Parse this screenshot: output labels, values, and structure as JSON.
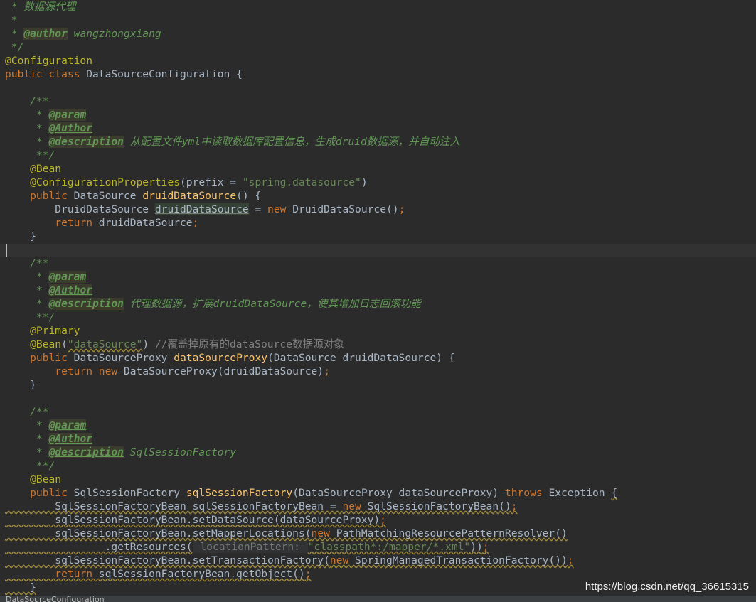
{
  "editor": {
    "lines": [
      [
        {
          "t": " * 数据源代理",
          "c": "cm"
        }
      ],
      [
        {
          "t": " *",
          "c": "cm"
        }
      ],
      [
        {
          "t": " * ",
          "c": "cm"
        },
        {
          "t": "@author",
          "c": "tag"
        },
        {
          "t": " wangzhongxiang",
          "c": "cm"
        }
      ],
      [
        {
          "t": " */",
          "c": "cm"
        }
      ],
      [
        {
          "t": "@Configuration",
          "c": "ann"
        }
      ],
      [
        {
          "t": "public class ",
          "c": "kw"
        },
        {
          "t": "DataSourceConfiguration {",
          "c": "pl"
        }
      ],
      [],
      [
        {
          "t": "    /**",
          "c": "cm"
        }
      ],
      [
        {
          "t": "     * ",
          "c": "cm"
        },
        {
          "t": "@param",
          "c": "tag"
        }
      ],
      [
        {
          "t": "     * ",
          "c": "cm"
        },
        {
          "t": "@Author",
          "c": "tag"
        }
      ],
      [
        {
          "t": "     * ",
          "c": "cm"
        },
        {
          "t": "@description",
          "c": "tag"
        },
        {
          "t": " 从配置文件",
          "c": "cm"
        },
        {
          "t": "yml",
          "c": "cm"
        },
        {
          "t": "中读取数据库配置信息，生成",
          "c": "cm"
        },
        {
          "t": "druid",
          "c": "cm"
        },
        {
          "t": "数据源，并自动注入",
          "c": "cm"
        }
      ],
      [
        {
          "t": "     **/",
          "c": "cm"
        }
      ],
      [
        {
          "t": "    @Bean",
          "c": "ann"
        }
      ],
      [
        {
          "t": "    @ConfigurationProperties",
          "c": "ann"
        },
        {
          "t": "(prefix = ",
          "c": "pl"
        },
        {
          "t": "\"spring.datasource\"",
          "c": "str"
        },
        {
          "t": ")",
          "c": "pl"
        }
      ],
      [
        {
          "t": "    public ",
          "c": "kw"
        },
        {
          "t": "DataSource ",
          "c": "pl"
        },
        {
          "t": "druidDataSource",
          "c": "fn"
        },
        {
          "t": "() {",
          "c": "pl"
        }
      ],
      [
        {
          "t": "        DruidDataSource ",
          "c": "pl"
        },
        {
          "t": "druidDataSource",
          "c": "pl hlvar"
        },
        {
          "t": " = ",
          "c": "pl"
        },
        {
          "t": "new ",
          "c": "kw"
        },
        {
          "t": "DruidDataSource()",
          "c": "pl"
        },
        {
          "t": ";",
          "c": "kw"
        }
      ],
      [
        {
          "t": "        return ",
          "c": "kw"
        },
        {
          "t": "druidDataSource",
          "c": "pl"
        },
        {
          "t": ";",
          "c": "kw"
        }
      ],
      [
        {
          "t": "    }",
          "c": "pl"
        }
      ],
      [],
      [
        {
          "t": "    /**",
          "c": "cm"
        }
      ],
      [
        {
          "t": "     * ",
          "c": "cm"
        },
        {
          "t": "@param",
          "c": "tag"
        }
      ],
      [
        {
          "t": "     * ",
          "c": "cm"
        },
        {
          "t": "@Author",
          "c": "tag"
        }
      ],
      [
        {
          "t": "     * ",
          "c": "cm"
        },
        {
          "t": "@description",
          "c": "tag"
        },
        {
          "t": " 代理数据源，扩展",
          "c": "cm"
        },
        {
          "t": "druidDataSource",
          "c": "cm"
        },
        {
          "t": "，使其增加日志回滚功能",
          "c": "cm"
        }
      ],
      [
        {
          "t": "     **/",
          "c": "cm"
        }
      ],
      [
        {
          "t": "    @Primary",
          "c": "ann"
        }
      ],
      [
        {
          "t": "    @Bean",
          "c": "ann"
        },
        {
          "t": "(",
          "c": "pl"
        },
        {
          "t": "\"dataSource\"",
          "c": "str warn"
        },
        {
          "t": ") ",
          "c": "pl"
        },
        {
          "t": "//覆盖掉原有的dataSource数据源对象",
          "c": "lc"
        }
      ],
      [
        {
          "t": "    public ",
          "c": "kw"
        },
        {
          "t": "DataSourceProxy ",
          "c": "pl"
        },
        {
          "t": "dataSourceProxy",
          "c": "fn"
        },
        {
          "t": "(DataSource druidDataSource) {",
          "c": "pl"
        }
      ],
      [
        {
          "t": "        return new ",
          "c": "kw"
        },
        {
          "t": "DataSourceProxy(druidDataSource)",
          "c": "pl"
        },
        {
          "t": ";",
          "c": "kw"
        }
      ],
      [
        {
          "t": "    }",
          "c": "pl"
        }
      ],
      [],
      [
        {
          "t": "    /**",
          "c": "cm"
        }
      ],
      [
        {
          "t": "     * ",
          "c": "cm"
        },
        {
          "t": "@param",
          "c": "tag"
        }
      ],
      [
        {
          "t": "     * ",
          "c": "cm"
        },
        {
          "t": "@Author",
          "c": "tag"
        }
      ],
      [
        {
          "t": "     * ",
          "c": "cm"
        },
        {
          "t": "@description",
          "c": "tag"
        },
        {
          "t": " SqlSessionFactory",
          "c": "cm"
        }
      ],
      [
        {
          "t": "     **/",
          "c": "cm"
        }
      ],
      [
        {
          "t": "    @Bean",
          "c": "ann"
        }
      ],
      [
        {
          "t": "    public ",
          "c": "kw"
        },
        {
          "t": "SqlSessionFactory ",
          "c": "pl"
        },
        {
          "t": "sqlSessionFactory",
          "c": "fn"
        },
        {
          "t": "(DataSourceProxy dataSourceProxy) ",
          "c": "pl"
        },
        {
          "t": "throws ",
          "c": "kw"
        },
        {
          "t": "Exception ",
          "c": "pl"
        },
        {
          "t": "{",
          "c": "pl warn"
        }
      ],
      [
        {
          "t": "        SqlSessionFactoryBean sqlSessionFactoryBean = ",
          "c": "pl warn"
        },
        {
          "t": "new ",
          "c": "kw warn"
        },
        {
          "t": "SqlSessionFactoryBean()",
          "c": "pl warn"
        },
        {
          "t": ";",
          "c": "kw warn"
        }
      ],
      [
        {
          "t": "        sqlSessionFactoryBean.setDataSource(dataSourceProxy)",
          "c": "pl warn"
        },
        {
          "t": ";",
          "c": "kw warn"
        }
      ],
      [
        {
          "t": "        sqlSessionFactoryBean.setMapperLocations(",
          "c": "pl warn"
        },
        {
          "t": "new ",
          "c": "kw warn"
        },
        {
          "t": "PathMatchingResourcePatternResolver()",
          "c": "pl warn"
        }
      ],
      [
        {
          "t": "                .getResources(",
          "c": "pl warn"
        },
        {
          "t": " locationPattern: ",
          "c": "hint"
        },
        {
          "t": "\"classpath*:/mapper/*.xml\"",
          "c": "str warn"
        },
        {
          "t": "))",
          "c": "pl warn"
        },
        {
          "t": ";",
          "c": "kw warn"
        }
      ],
      [
        {
          "t": "        sqlSessionFactoryBean.setTransactionFactory(",
          "c": "pl warn"
        },
        {
          "t": "new ",
          "c": "kw warn"
        },
        {
          "t": "SpringManagedTransactionFactory())",
          "c": "pl warn"
        },
        {
          "t": ";",
          "c": "kw warn"
        }
      ],
      [
        {
          "t": "        return ",
          "c": "kw warn"
        },
        {
          "t": "sqlSessionFactoryBean.getObject()",
          "c": "pl warn"
        },
        {
          "t": ";",
          "c": "kw warn"
        }
      ],
      [
        {
          "t": "    }",
          "c": "pl warn"
        }
      ]
    ]
  },
  "status": {
    "breadcrumb": "DataSourceConfiguration"
  },
  "watermark": {
    "text": "https://blog.csdn.net/qq_36615315"
  },
  "colors": {
    "background": "#2b2b2b",
    "comment": "#629755",
    "keyword": "#cc7832",
    "annotation": "#bbb529",
    "string": "#6a8759",
    "method": "#ffc66d",
    "plain": "#a9b7c6"
  }
}
